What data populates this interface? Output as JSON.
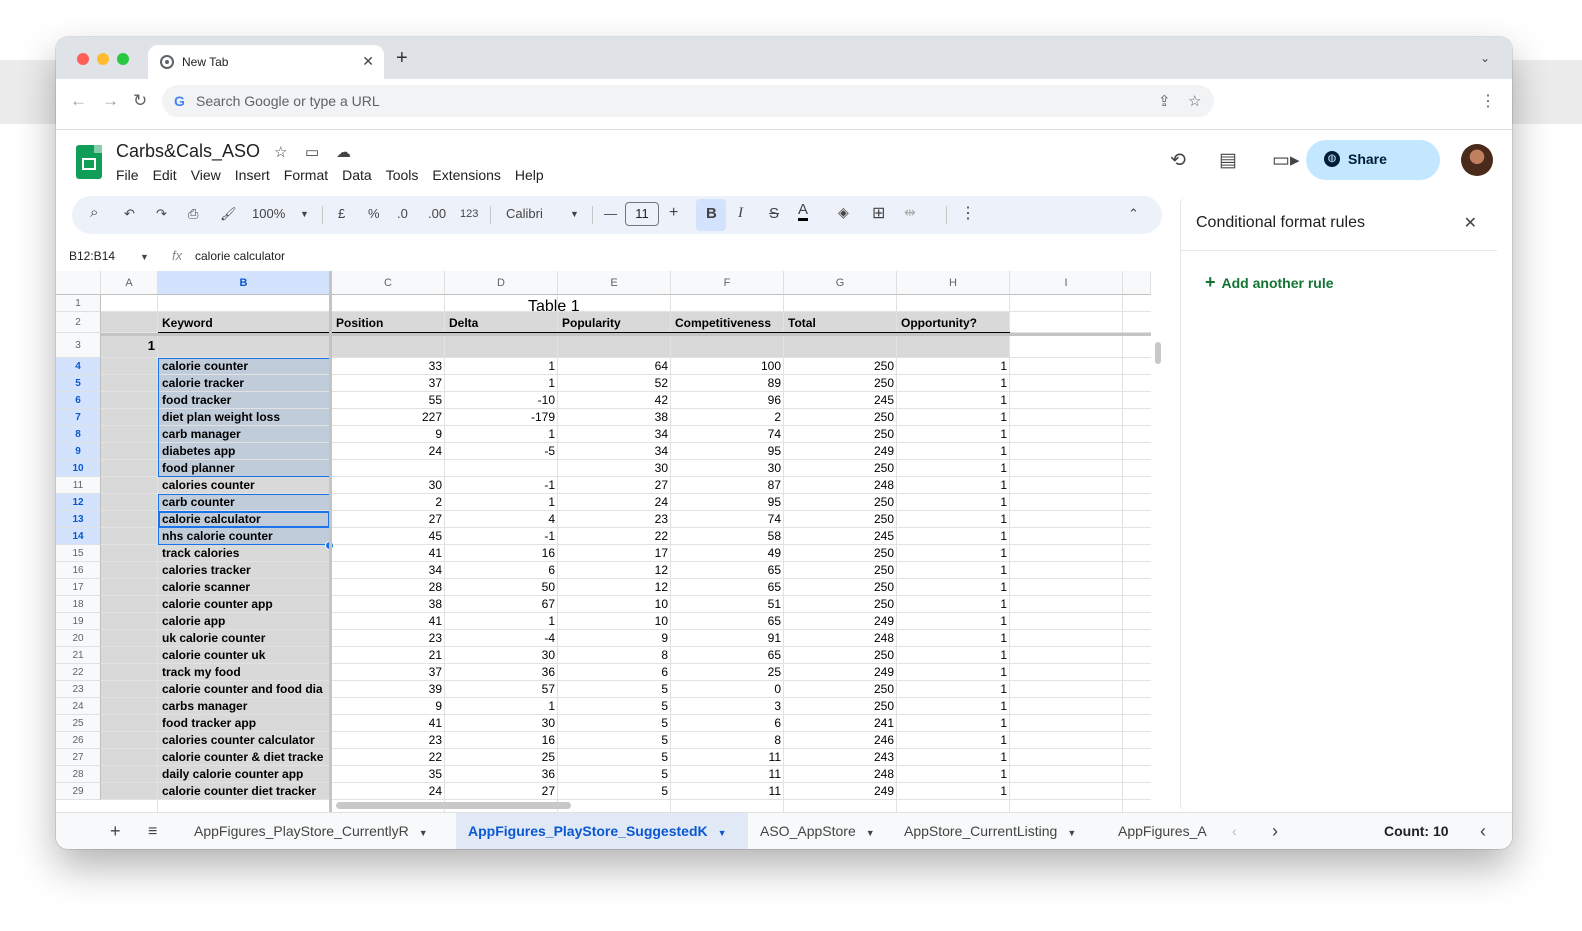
{
  "browser": {
    "tab_title": "New Tab",
    "omnibox_placeholder": "Search Google or type a URL"
  },
  "sheets": {
    "doc_title": "Carbs&Cals_ASO",
    "menu": [
      "File",
      "Edit",
      "View",
      "Insert",
      "Format",
      "Data",
      "Tools",
      "Extensions",
      "Help"
    ],
    "share_label": "Share"
  },
  "toolbar": {
    "zoom": "100%",
    "currency": "£",
    "percent": "%",
    "dec_decrease": ".0",
    "dec_increase": ".00",
    "number_format": "123",
    "font": "Calibri",
    "font_size": "11",
    "bold": "B",
    "italic": "I"
  },
  "formula_bar": {
    "name_box": "B12:B14",
    "value": "calorie calculator"
  },
  "side_panel": {
    "title": "Conditional format rules",
    "add_rule": "Add another rule"
  },
  "grid": {
    "columns": [
      "A",
      "B",
      "C",
      "D",
      "E",
      "F",
      "G",
      "H",
      "I"
    ],
    "table_title": "Table 1",
    "headers": [
      "Keyword",
      "Position",
      "Delta",
      "Popularity",
      "Competitiveness",
      "Total",
      "Opportunity?"
    ],
    "row3_a": "1",
    "row_numbers": [
      "1",
      "2",
      "3",
      "4",
      "5",
      "6",
      "7",
      "8",
      "9",
      "10",
      "11",
      "12",
      "13",
      "14",
      "15",
      "16",
      "17",
      "18",
      "19",
      "20",
      "21",
      "22",
      "23",
      "24",
      "25",
      "26",
      "27",
      "28",
      "29"
    ],
    "rows": [
      {
        "kw": "calorie counter",
        "pos": "33",
        "delta": "1",
        "pop": "64",
        "comp": "100",
        "total": "250",
        "opp": "1"
      },
      {
        "kw": "calorie tracker",
        "pos": "37",
        "delta": "1",
        "pop": "52",
        "comp": "89",
        "total": "250",
        "opp": "1"
      },
      {
        "kw": "food tracker",
        "pos": "55",
        "delta": "-10",
        "pop": "42",
        "comp": "96",
        "total": "245",
        "opp": "1"
      },
      {
        "kw": "diet plan weight loss",
        "pos": "227",
        "delta": "-179",
        "pop": "38",
        "comp": "2",
        "total": "250",
        "opp": "1"
      },
      {
        "kw": "carb manager",
        "pos": "9",
        "delta": "1",
        "pop": "34",
        "comp": "74",
        "total": "250",
        "opp": "1"
      },
      {
        "kw": "diabetes app",
        "pos": "24",
        "delta": "-5",
        "pop": "34",
        "comp": "95",
        "total": "249",
        "opp": "1"
      },
      {
        "kw": "food planner",
        "pos": "",
        "delta": "",
        "pop": "30",
        "comp": "30",
        "total": "250",
        "opp": "1"
      },
      {
        "kw": "calories counter",
        "pos": "30",
        "delta": "-1",
        "pop": "27",
        "comp": "87",
        "total": "248",
        "opp": "1"
      },
      {
        "kw": "carb counter",
        "pos": "2",
        "delta": "1",
        "pop": "24",
        "comp": "95",
        "total": "250",
        "opp": "1"
      },
      {
        "kw": "calorie calculator",
        "pos": "27",
        "delta": "4",
        "pop": "23",
        "comp": "74",
        "total": "250",
        "opp": "1"
      },
      {
        "kw": "nhs calorie counter",
        "pos": "45",
        "delta": "-1",
        "pop": "22",
        "comp": "58",
        "total": "245",
        "opp": "1"
      },
      {
        "kw": "track calories",
        "pos": "41",
        "delta": "16",
        "pop": "17",
        "comp": "49",
        "total": "250",
        "opp": "1"
      },
      {
        "kw": "calories tracker",
        "pos": "34",
        "delta": "6",
        "pop": "12",
        "comp": "65",
        "total": "250",
        "opp": "1"
      },
      {
        "kw": "calorie scanner",
        "pos": "28",
        "delta": "50",
        "pop": "12",
        "comp": "65",
        "total": "250",
        "opp": "1"
      },
      {
        "kw": "calorie counter app",
        "pos": "38",
        "delta": "67",
        "pop": "10",
        "comp": "51",
        "total": "250",
        "opp": "1"
      },
      {
        "kw": "calorie app",
        "pos": "41",
        "delta": "1",
        "pop": "10",
        "comp": "65",
        "total": "249",
        "opp": "1"
      },
      {
        "kw": "uk calorie counter",
        "pos": "23",
        "delta": "-4",
        "pop": "9",
        "comp": "91",
        "total": "248",
        "opp": "1"
      },
      {
        "kw": "calorie counter uk",
        "pos": "21",
        "delta": "30",
        "pop": "8",
        "comp": "65",
        "total": "250",
        "opp": "1"
      },
      {
        "kw": "track my food",
        "pos": "37",
        "delta": "36",
        "pop": "6",
        "comp": "25",
        "total": "249",
        "opp": "1"
      },
      {
        "kw": "calorie counter and food dia",
        "pos": "39",
        "delta": "57",
        "pop": "5",
        "comp": "0",
        "total": "250",
        "opp": "1"
      },
      {
        "kw": "carbs manager",
        "pos": "9",
        "delta": "1",
        "pop": "5",
        "comp": "3",
        "total": "250",
        "opp": "1"
      },
      {
        "kw": "food tracker app",
        "pos": "41",
        "delta": "30",
        "pop": "5",
        "comp": "6",
        "total": "241",
        "opp": "1"
      },
      {
        "kw": "calories counter calculator",
        "pos": "23",
        "delta": "16",
        "pop": "5",
        "comp": "8",
        "total": "246",
        "opp": "1"
      },
      {
        "kw": "calorie counter & diet tracke",
        "pos": "22",
        "delta": "25",
        "pop": "5",
        "comp": "11",
        "total": "243",
        "opp": "1"
      },
      {
        "kw": "daily calorie counter app",
        "pos": "35",
        "delta": "36",
        "pop": "5",
        "comp": "11",
        "total": "248",
        "opp": "1"
      },
      {
        "kw": "calorie counter diet tracker",
        "pos": "24",
        "delta": "27",
        "pop": "5",
        "comp": "11",
        "total": "249",
        "opp": "1"
      }
    ]
  },
  "bottom_bar": {
    "sheet_tabs": [
      {
        "label": "AppFigures_PlayStore_CurrentlyR",
        "active": false
      },
      {
        "label": "AppFigures_PlayStore_SuggestedK",
        "active": true
      },
      {
        "label": "ASO_AppStore",
        "active": false
      },
      {
        "label": "AppStore_CurrentListing",
        "active": false
      },
      {
        "label": "AppFigures_A",
        "active": false
      }
    ],
    "count": "Count: 10"
  }
}
